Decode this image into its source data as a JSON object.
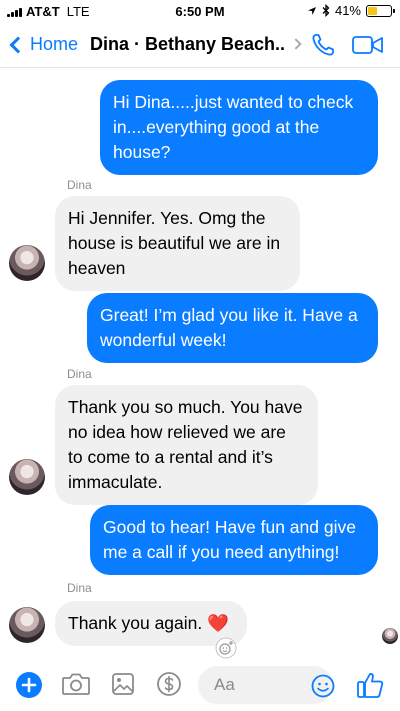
{
  "status_bar": {
    "carrier": "AT&T",
    "network": "LTE",
    "time": "6:50 PM",
    "battery_percent": "41%",
    "battery_level": 0.41
  },
  "nav": {
    "back_label": "Home",
    "title": "Dina · Bethany Beach..."
  },
  "messages": [
    {
      "direction": "outgoing",
      "text": "Hi Dina.....just wanted to check in....everything good at the house?"
    },
    {
      "direction": "incoming",
      "sender": "Dina",
      "text": "Hi Jennifer.  Yes. Omg the house is beautiful we are in heaven"
    },
    {
      "direction": "outgoing",
      "text": "Great! I’m glad you like it. Have a wonderful week!"
    },
    {
      "direction": "incoming",
      "sender": "Dina",
      "text": "Thank you so much.  You have no idea how relieved we are to come to a rental and it’s immaculate."
    },
    {
      "direction": "outgoing",
      "text": "Good to hear! Have fun and give me a call if you need anything!"
    },
    {
      "direction": "incoming",
      "sender": "Dina",
      "text": "Thank you again. ",
      "emoji": "❤️"
    }
  ],
  "composer": {
    "placeholder": "Aa"
  },
  "colors": {
    "accent": "#0a7cff",
    "incoming_bubble": "#f0f0f0",
    "battery": "#f5c518"
  }
}
